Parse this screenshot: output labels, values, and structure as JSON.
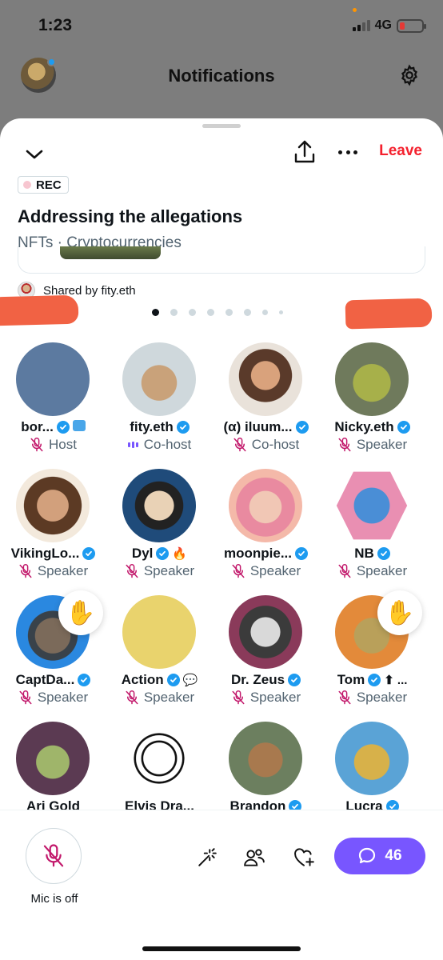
{
  "status_bar": {
    "time": "1:23",
    "network": "4G"
  },
  "background": {
    "title": "Notifications"
  },
  "space": {
    "leave_label": "Leave",
    "rec_label": "REC",
    "title": "Addressing the allegations",
    "topics": "NFTs · Cryptocurrencies",
    "shared_by": "Shared by fity.eth",
    "pager": {
      "count": 8,
      "active": 1
    }
  },
  "participants": [
    {
      "name": "bor...",
      "verified": true,
      "extra": "badge",
      "role": "Host",
      "role_icon": "mic-off-icon",
      "avatar": "pixel-punk-avatar"
    },
    {
      "name": "fity.eth",
      "verified": true,
      "role": "Co-host",
      "role_icon": "speaking-bars-icon",
      "avatar": "ape-fez-avatar"
    },
    {
      "name": "(α) iluum...",
      "verified": true,
      "role": "Co-host",
      "role_icon": "mic-off-icon",
      "avatar": "woman-photo-avatar"
    },
    {
      "name": "Nicky.eth",
      "verified": true,
      "role": "Speaker",
      "role_icon": "mic-off-icon",
      "avatar": "ape-hat-avatar"
    },
    {
      "name": "VikingLo...",
      "verified": true,
      "role": "Speaker",
      "role_icon": "mic-off-icon",
      "avatar": "viking-avatar"
    },
    {
      "name": "Dyl",
      "verified": true,
      "extra": "🔥",
      "role": "Speaker",
      "role_icon": "mic-off-icon",
      "avatar": "anime-avatar"
    },
    {
      "name": "moonpie...",
      "verified": true,
      "role": "Speaker",
      "role_icon": "mic-off-icon",
      "avatar": "pink-hair-avatar"
    },
    {
      "name": "NB",
      "verified": true,
      "role": "Speaker",
      "role_icon": "mic-off-icon",
      "avatar": "blue-bear-avatar"
    },
    {
      "name": "CaptDa...",
      "verified": true,
      "role": "Speaker",
      "role_icon": "mic-off-icon",
      "avatar": "ape-halo-avatar",
      "hand_raised": true,
      "hand": "✋"
    },
    {
      "name": "Action",
      "verified": true,
      "extra": "💬",
      "role": "Speaker",
      "role_icon": "mic-off-icon",
      "avatar": "pixel-suit-avatar"
    },
    {
      "name": "Dr. Zeus",
      "verified": true,
      "role": "Speaker",
      "role_icon": "mic-off-icon",
      "avatar": "skeleton-ape-avatar"
    },
    {
      "name": "Tom",
      "verified": true,
      "extra": "⬆ ...",
      "role": "Speaker",
      "role_icon": "mic-off-icon",
      "avatar": "ape-orange-avatar",
      "hand_raised": true,
      "hand": "✋"
    },
    {
      "name": "Ari Gold",
      "verified": false,
      "role": "",
      "avatar": "zombie-ape-avatar"
    },
    {
      "name": "Elvis Dra...",
      "verified": false,
      "role": "",
      "avatar": "anonymous-avatar"
    },
    {
      "name": "Brandon",
      "verified": true,
      "role": "",
      "avatar": "ape-green-avatar"
    },
    {
      "name": "Lucra",
      "verified": true,
      "role": "",
      "avatar": "ape-party-avatar"
    }
  ],
  "bottom_bar": {
    "mic_label": "Mic is off",
    "chat_count": "46"
  },
  "colors": {
    "accent_purple": "#7856ff",
    "leave_red": "#f4212e",
    "verified_blue": "#1d9bf0",
    "muted_pink": "#c2186b"
  }
}
